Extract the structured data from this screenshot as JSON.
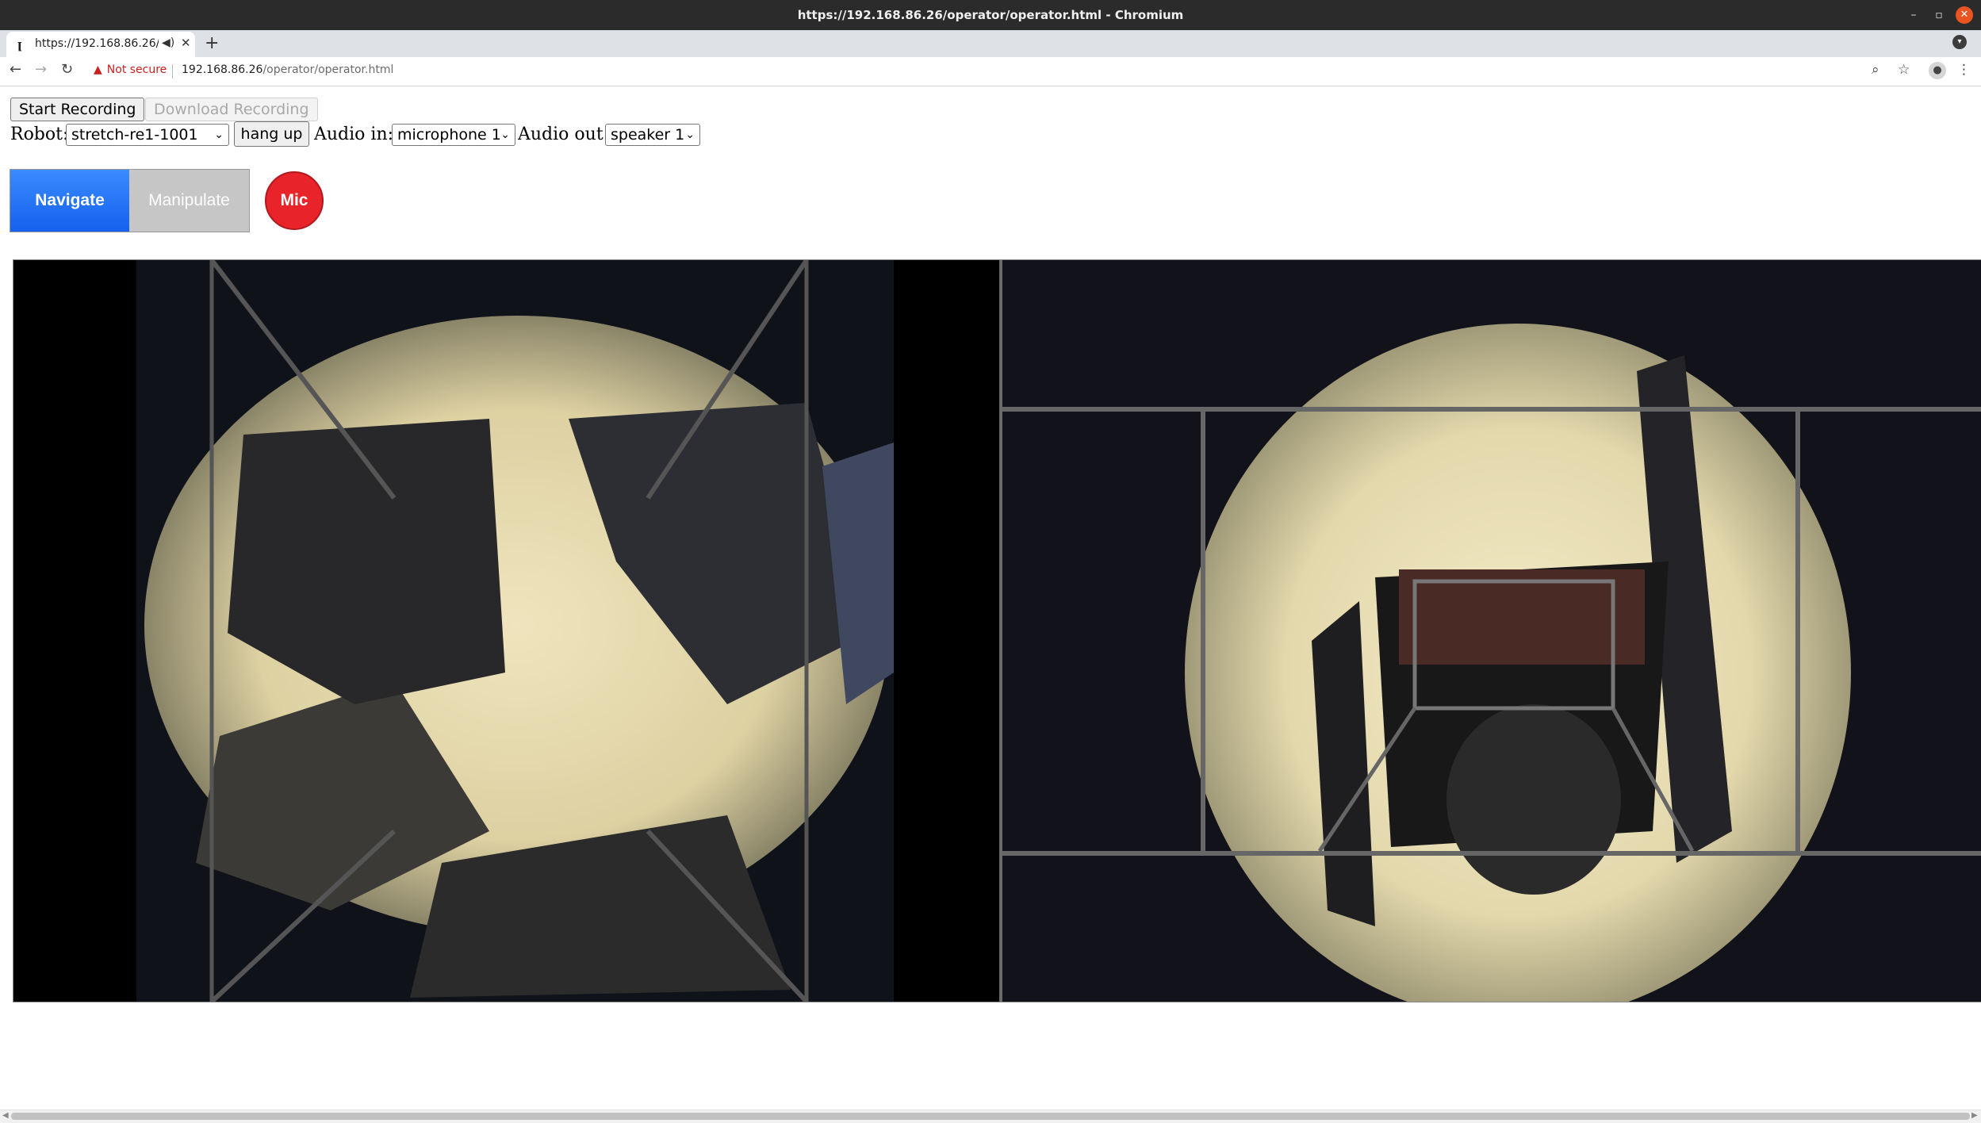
{
  "window": {
    "title": "https://192.168.86.26/operator/operator.html - Chromium"
  },
  "tab": {
    "favicon": "ꞁ",
    "title": "https://192.168.86.26/",
    "audio_icon": "speaker-muted-icon",
    "close_icon": "close-icon"
  },
  "address_bar": {
    "security_label": "Not secure",
    "host": "192.168.86.26",
    "path": "/operator/operator.html"
  },
  "recording": {
    "start_label": "Start Recording",
    "download_label": "Download Recording"
  },
  "controls": {
    "robot_label": "Robot:",
    "robot_value": "stretch-re1-1001",
    "hangup_label": "hang up",
    "audio_in_label": "Audio in:",
    "audio_in_value": "microphone 1",
    "audio_out_label": "Audio out:",
    "audio_out_value": "speaker 1"
  },
  "modes": {
    "navigate_label": "Navigate",
    "manipulate_label": "Manipulate",
    "active": "Navigate"
  },
  "mic": {
    "label": "Mic",
    "color": "#e8232a"
  },
  "colors": {
    "navigate_blue": "#1f6ff5",
    "mic_red": "#e8232a",
    "titlebar": "#2b2b2b"
  }
}
